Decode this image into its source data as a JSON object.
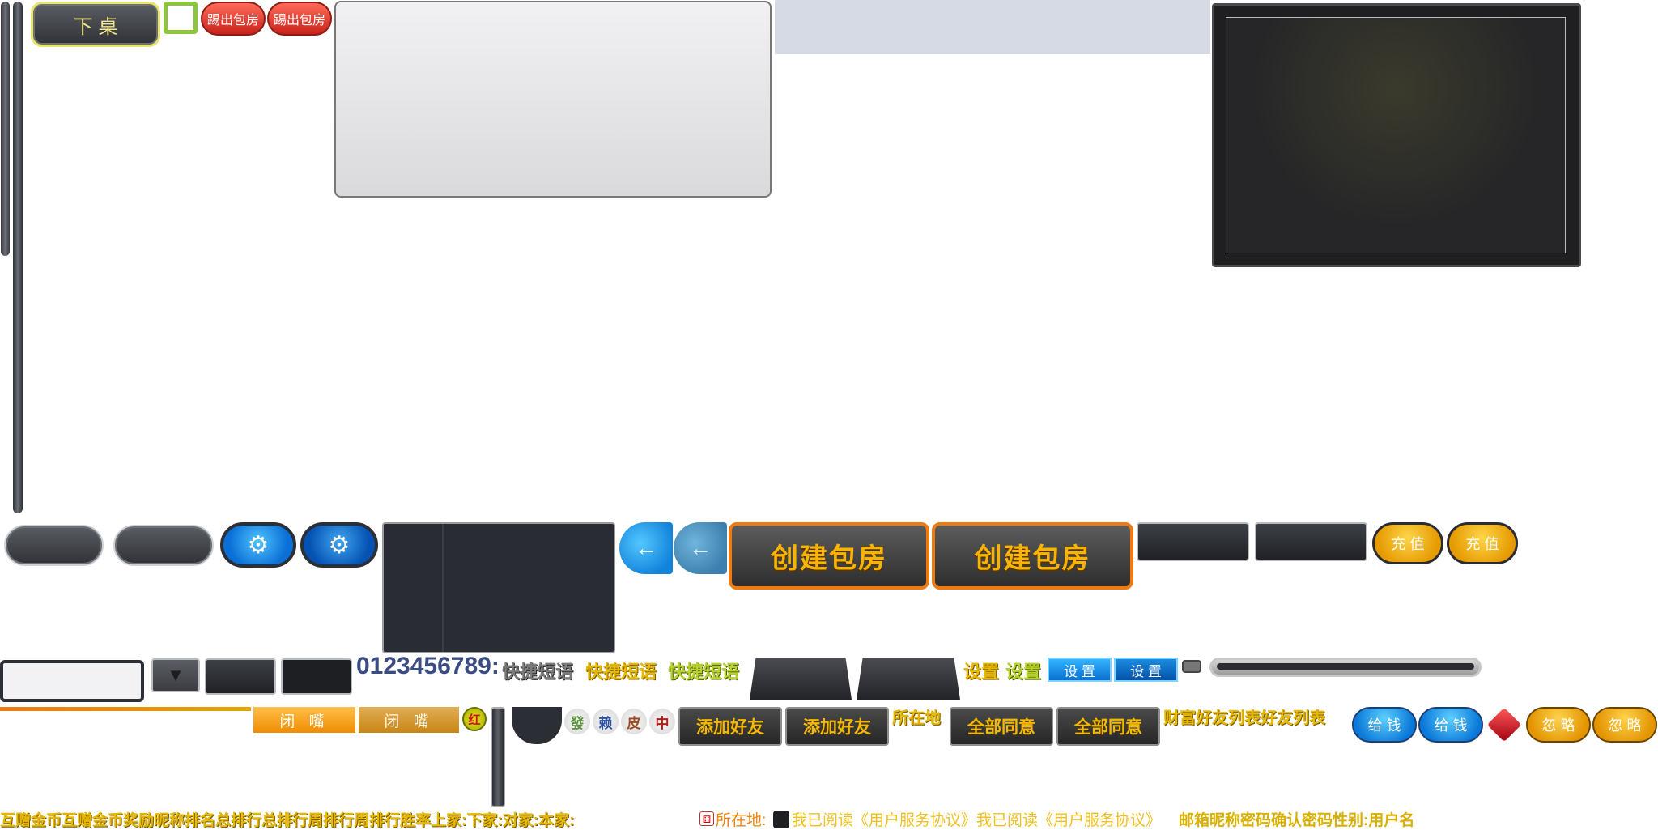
{
  "top": {
    "leave_table": "下 桌",
    "kick_room_1": "踢出包房",
    "kick_room_2": "踢出包房"
  },
  "row_mid": {
    "create_room_1": "创建包房",
    "create_room_2": "创建包房",
    "recharge_1": "充 值",
    "recharge_2": "充 值"
  },
  "row_low": {
    "digits": "0123456789:",
    "quick_phrase_1": "快捷短语",
    "quick_phrase_2": "快捷短语",
    "quick_phrase_3": "快捷短语",
    "settings_text_1": "设置",
    "settings_text_2": "设置",
    "settings_btn_1": "设 置",
    "settings_btn_2": "设 置"
  },
  "row_friends": {
    "mute_1": "闭 嘴",
    "mute_2": "闭 嘴",
    "red_badge": "红",
    "tiles": [
      "發",
      "赖",
      "皮",
      "中"
    ],
    "add_friend_1": "添加好友",
    "add_friend_2": "添加好友",
    "location": "所在地",
    "agree_all_1": "全部同意",
    "agree_all_2": "全部同意",
    "wealth_friends": "财富好友列表好友列表",
    "give_money_1": "给 钱",
    "give_money_2": "给 钱",
    "ignore_1": "忽 略",
    "ignore_2": "忽 略"
  },
  "bottom": {
    "gold_strip": "互赠金币互赠金币奖励昵称排名总排行总排行周排行周排行胜率上家:下家:对家:本家:",
    "location_label": "所在地:",
    "agreement": "我已阅读《用户服务协议》我已阅读《用户服务协议》",
    "form_labels": "邮箱昵称密码确认密码性别:用户名"
  },
  "colors": {
    "accent_orange": "#f07a12",
    "gold": "#e6b800",
    "blue": "#0b6fd1"
  }
}
